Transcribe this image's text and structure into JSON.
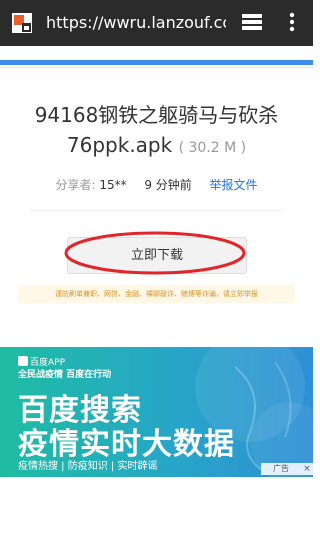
{
  "browser": {
    "url": "https://wwru.lanzouf.com",
    "site_icon": "site-favicon-icon",
    "tabs_icon": "tabs-icon",
    "menu_icon": "more-vertical-icon"
  },
  "file": {
    "name": "94168钢铁之躯骑马与砍杀76ppk.apk",
    "size": "( 30.2 M )",
    "sharer_label": "分享者:",
    "sharer": "15**",
    "time": "9 分钟前",
    "report_label": "举报文件"
  },
  "download": {
    "button_label": "立即下载"
  },
  "warning": {
    "text": "谨防刷单兼职、网贷、金融、裸聊敲诈、赌博等诈骗，请立即举报"
  },
  "ad": {
    "brand": "百度APP",
    "slogan": "全民战疫情 百度在行动",
    "headline1": "百度搜索",
    "headline2": "疫情实时大数据",
    "links": "疫情热搜 | 防疫知识 | 实时辟谣",
    "tag": "广告",
    "close": "×"
  },
  "colors": {
    "toolbar": "#2b2b2b",
    "accent_blue": "#3d8ce8",
    "link": "#1e78d7",
    "annotation_red": "#e0262b",
    "warning_text": "#d8922a",
    "ad_green": "#1fbca2"
  }
}
